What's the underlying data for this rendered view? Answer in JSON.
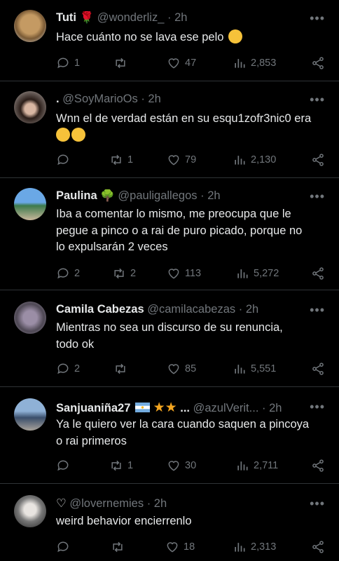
{
  "tweets": [
    {
      "name": "Tuti",
      "handle": "@wonderliz_",
      "time": "2h",
      "text": "Hace cuánto no se lava ese pelo",
      "replies": "1",
      "retweets": "",
      "likes": "47",
      "views": "2,853"
    },
    {
      "name": ".",
      "handle": "@SoyMarioOs",
      "time": "2h",
      "text": "Wnn el de verdad están en su esqu1zofr3nic0 era",
      "replies": "",
      "retweets": "1",
      "likes": "79",
      "views": "2,130"
    },
    {
      "name": "Paulina",
      "handle": "@pauligallegos",
      "time": "2h",
      "text_lines": [
        "Iba a comentar lo mismo, me preocupa que le",
        "pegue a pinco o a rai de puro picado, porque no",
        "lo expulsarán 2 veces"
      ],
      "replies": "2",
      "retweets": "2",
      "likes": "113",
      "views": "5,272"
    },
    {
      "name": "Camila Cabezas",
      "handle": "@camilacabezas",
      "time": "2h",
      "text_lines": [
        "Mientras no sea un discurso de su renuncia,",
        "todo ok"
      ],
      "replies": "2",
      "retweets": "",
      "likes": "85",
      "views": "5,551"
    },
    {
      "name": "Sanjuaniña27",
      "name_suffix": "...",
      "handle": "@azulVerit...",
      "time": "2h",
      "text_lines": [
        "Ya le quiero ver la cara cuando saquen a pincoya",
        "o rai primeros"
      ],
      "replies": "",
      "retweets": "1",
      "likes": "30",
      "views": "2,711"
    },
    {
      "name": "",
      "handle": "@lovernemies",
      "time": "2h",
      "text": "weird behavior encierrenlo",
      "replies": "",
      "retweets": "",
      "likes": "18",
      "views": "2,313"
    }
  ],
  "sep": "·",
  "more": "•••",
  "colors": {
    "background": "#000000",
    "text": "#e7e9ea",
    "muted": "#71767b",
    "divider": "#2f3336"
  }
}
